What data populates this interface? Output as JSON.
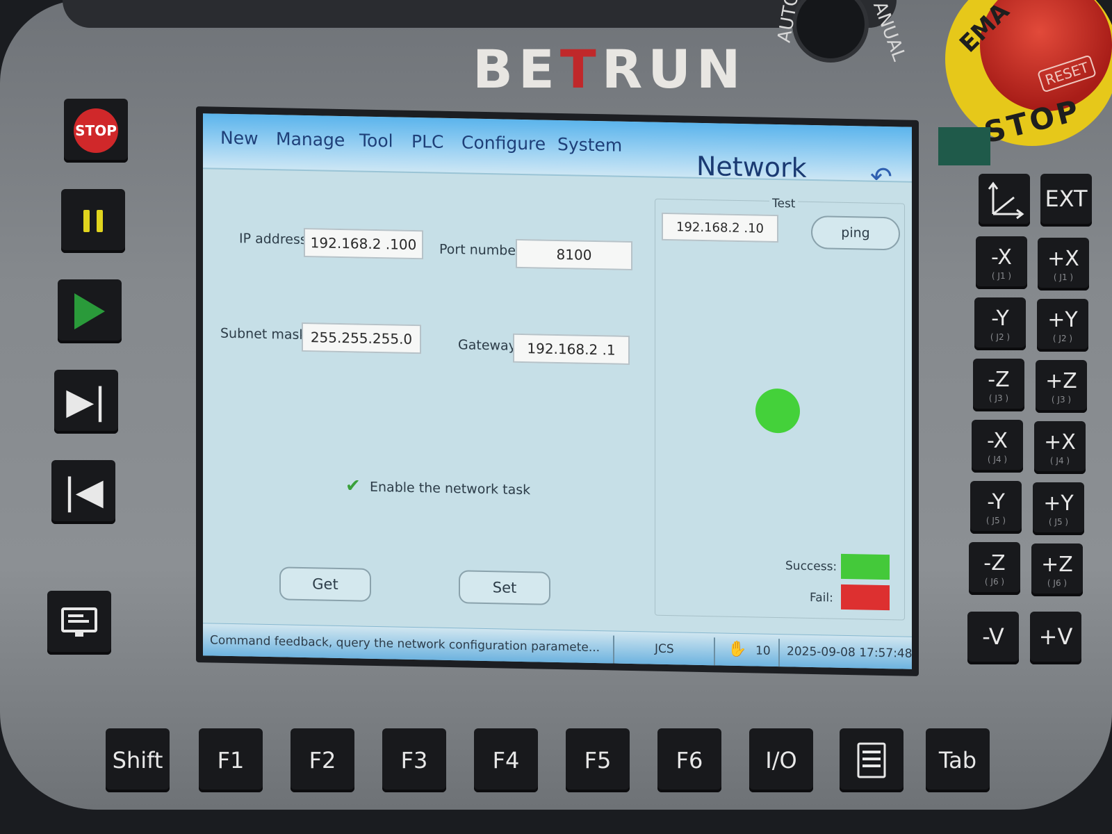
{
  "device": {
    "brand_left": "BE",
    "brand_accent": "T",
    "brand_right": "RUN",
    "mode_auto": "AUTO",
    "mode_manual": "ANUAL",
    "estop_top": "EMA",
    "estop_bottom": "STOP",
    "estop_reset": "RESET",
    "colors": {
      "estop_red": "#c0282a",
      "estop_yellow": "#e6c81a",
      "play_green": "#2a9a3a",
      "pause_yellow": "#e0d41e"
    }
  },
  "left_keys": [
    {
      "name": "stop",
      "label": "STOP"
    },
    {
      "name": "pause",
      "label": ""
    },
    {
      "name": "run",
      "label": ""
    },
    {
      "name": "step-forward",
      "label": ""
    },
    {
      "name": "step-back",
      "label": ""
    },
    {
      "name": "monitor",
      "label": ""
    }
  ],
  "menu": {
    "items": [
      "New",
      "Manage",
      "Tool",
      "PLC",
      "Configure",
      "System"
    ],
    "page_title": "Network",
    "back_icon": "undo-arrow-icon"
  },
  "network": {
    "ip_label": "IP address:",
    "ip_value": "192.168.2  .100",
    "port_label": "Port number:",
    "port_value": "8100",
    "subnet_label": "Subnet mask:",
    "subnet_value": "255.255.255.0",
    "gateway_label": "Gateway:",
    "gateway_value": "192.168.2  .1",
    "enable_label": "Enable the network task",
    "enable_checked": true,
    "get_label": "Get",
    "set_label": "Set"
  },
  "test": {
    "legend": "Test",
    "target_ip": "192.168.2  .10",
    "ping_label": "ping",
    "status": "success",
    "success_label": "Success:",
    "fail_label": "Fail:",
    "success_color": "#44d13a",
    "fail_color": "#dd3030"
  },
  "statusbar": {
    "feedback": "Command feedback, query the network configuration paramete...",
    "coord_system": "JCS",
    "speed": "10",
    "datetime": "2025-09-08 17:57:48"
  },
  "right_keys": {
    "ext": "EXT",
    "jog": [
      {
        "minus": "-X",
        "plus": "+X",
        "sub": "( J1 )"
      },
      {
        "minus": "-Y",
        "plus": "+Y",
        "sub": "( J2 )"
      },
      {
        "minus": "-Z",
        "plus": "+Z",
        "sub": "( J3 )"
      },
      {
        "minus": "-X",
        "plus": "+X",
        "sub": "( J4 )"
      },
      {
        "minus": "-Y",
        "plus": "+Y",
        "sub": "( J5 )"
      },
      {
        "minus": "-Z",
        "plus": "+Z",
        "sub": "( J6 )"
      }
    ],
    "v_minus": "-V",
    "v_plus": "+V"
  },
  "function_keys": [
    "Shift",
    "F1",
    "F2",
    "F3",
    "F4",
    "F5",
    "F6",
    "I/O",
    "",
    "Tab"
  ]
}
